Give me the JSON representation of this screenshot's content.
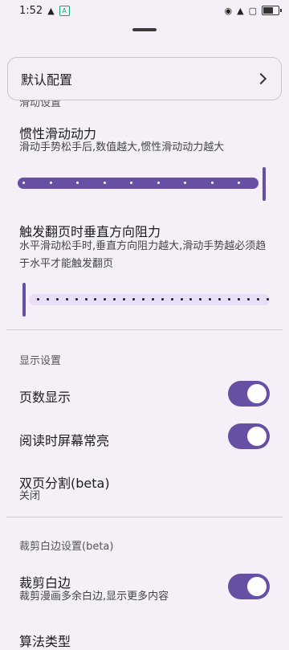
{
  "status_bar": {
    "time": "1:52",
    "icons": [
      "person-icon",
      "app-badge-icon",
      "eye-icon",
      "wifi-icon",
      "sim-x-icon",
      "battery-icon"
    ]
  },
  "default_config": {
    "label": "默认配置"
  },
  "scroll_section": {
    "label": "滑动设置"
  },
  "inertia": {
    "title": "惯性滑动动力",
    "subtitle": "滑动手势松手后,数值越大,惯性滑动动力越大",
    "value_fraction": 1.0
  },
  "resistance": {
    "title": "触发翻页时垂直方向阻力",
    "subtitle": "水平滑动松手时,垂直方向阻力越大,滑动手势越必须趋于水平才能触发翻页",
    "value_fraction": 0.0
  },
  "display_section": {
    "label": "显示设置"
  },
  "page_number": {
    "label": "页数显示",
    "on": true
  },
  "screen_on": {
    "label": "阅读时屏幕常亮",
    "on": true
  },
  "split_page": {
    "title": "双页分割(beta)",
    "value": "关闭"
  },
  "crop_section": {
    "label": "裁剪白边设置(beta)"
  },
  "crop": {
    "title": "裁剪白边",
    "subtitle": "裁剪漫画多余白边,显示更多内容",
    "on": true
  },
  "algorithm": {
    "title": "算法类型"
  },
  "colors": {
    "accent": "#6750a4",
    "track_inactive": "#e8def8",
    "background": "#f5eff8"
  }
}
